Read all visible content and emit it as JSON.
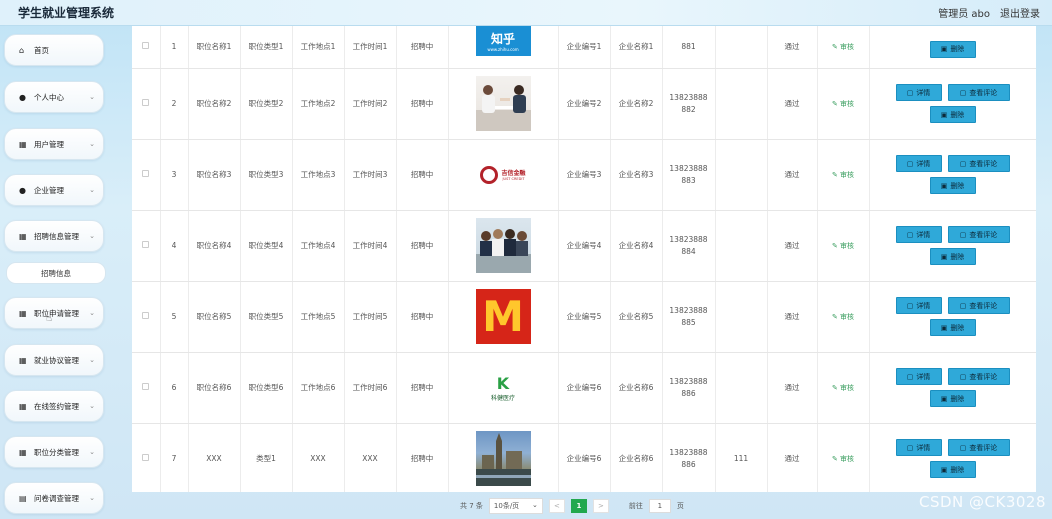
{
  "app": {
    "title": "学生就业管理系统"
  },
  "topbar": {
    "user_label": "管理员 abo",
    "logout_label": "退出登录"
  },
  "sidebar": {
    "items": [
      {
        "label": "首页",
        "icon": "home-icon",
        "chevron": false
      },
      {
        "label": "个人中心",
        "icon": "person-icon",
        "chevron": true
      },
      {
        "label": "用户管理",
        "icon": "grid-icon",
        "chevron": true
      },
      {
        "label": "企业管理",
        "icon": "person-icon",
        "chevron": true
      },
      {
        "label": "招聘信息管理",
        "icon": "grid-icon",
        "chevron": true
      },
      {
        "label": "职位申请管理",
        "icon": "grid-icon",
        "chevron": true
      },
      {
        "label": "就业协议管理",
        "icon": "grid-icon",
        "chevron": true
      },
      {
        "label": "在线签约管理",
        "icon": "grid-icon",
        "chevron": true
      },
      {
        "label": "职位分类管理",
        "icon": "grid-icon",
        "chevron": true
      },
      {
        "label": "问卷调查管理",
        "icon": "doc-icon",
        "chevron": true
      }
    ],
    "sub_item": {
      "label": "招聘信息"
    }
  },
  "table": {
    "buttons": {
      "detail": "详情",
      "comment": "查看评论",
      "delete": "删除"
    },
    "review_label": "审核",
    "rows": [
      {
        "idx": "1",
        "name": "职位名称1",
        "type": "职位类型1",
        "place": "工作地点1",
        "time": "工作时间1",
        "status": "招聘中",
        "logo": "zhihu-logo",
        "code": "企业编号1",
        "company": "企业名称1",
        "phone": "881",
        "extra": "",
        "audit": "通过"
      },
      {
        "idx": "2",
        "name": "职位名称2",
        "type": "职位类型2",
        "place": "工作地点2",
        "time": "工作时间2",
        "status": "招聘中",
        "logo": "meeting-photo",
        "code": "企业编号2",
        "company": "企业名称2",
        "phone": "13823888 882",
        "extra": "",
        "audit": "通过"
      },
      {
        "idx": "3",
        "name": "职位名称3",
        "type": "职位类型3",
        "place": "工作地点3",
        "time": "工作时间3",
        "status": "招聘中",
        "logo": "jixin-logo",
        "code": "企业编号3",
        "company": "企业名称3",
        "phone": "13823888 883",
        "extra": "",
        "audit": "通过"
      },
      {
        "idx": "4",
        "name": "职位名称4",
        "type": "职位类型4",
        "place": "工作地点4",
        "time": "工作时间4",
        "status": "招聘中",
        "logo": "team-photo",
        "code": "企业编号4",
        "company": "企业名称4",
        "phone": "13823888 884",
        "extra": "",
        "audit": "通过"
      },
      {
        "idx": "5",
        "name": "职位名称5",
        "type": "职位类型5",
        "place": "工作地点5",
        "time": "工作时间5",
        "status": "招聘中",
        "logo": "mcdonalds-logo",
        "code": "企业编号5",
        "company": "企业名称5",
        "phone": "13823888 885",
        "extra": "",
        "audit": "通过"
      },
      {
        "idx": "6",
        "name": "职位名称6",
        "type": "职位类型6",
        "place": "工作地点6",
        "time": "工作时间6",
        "status": "招聘中",
        "logo": "kejian-logo",
        "code": "企业编号6",
        "company": "企业名称6",
        "phone": "13823888 886",
        "extra": "",
        "audit": "通过"
      },
      {
        "idx": "7",
        "name": "XXX",
        "type": "类型1",
        "place": "XXX",
        "time": "XXX",
        "status": "招聘中",
        "logo": "city-photo",
        "code": "企业编号6",
        "company": "企业名称6",
        "phone": "13823888 886",
        "extra": "111",
        "audit": "通过"
      }
    ],
    "logos": {
      "zhihu": {
        "text": "知乎",
        "sub": "www.zhihu.com"
      },
      "jixin": {
        "text": "吉信金融",
        "sub": "JUST CREDIT"
      },
      "mcd": {
        "text": "M"
      },
      "kejian": {
        "mark": "K",
        "text": "科健医疗"
      }
    }
  },
  "pager": {
    "total": "共 7 条",
    "page_size": "10条/页",
    "prev": "<",
    "current": "1",
    "next": ">",
    "goto_label": "前往",
    "goto_value": "1",
    "page_unit": "页"
  },
  "watermark": "CSDN @CK3028"
}
